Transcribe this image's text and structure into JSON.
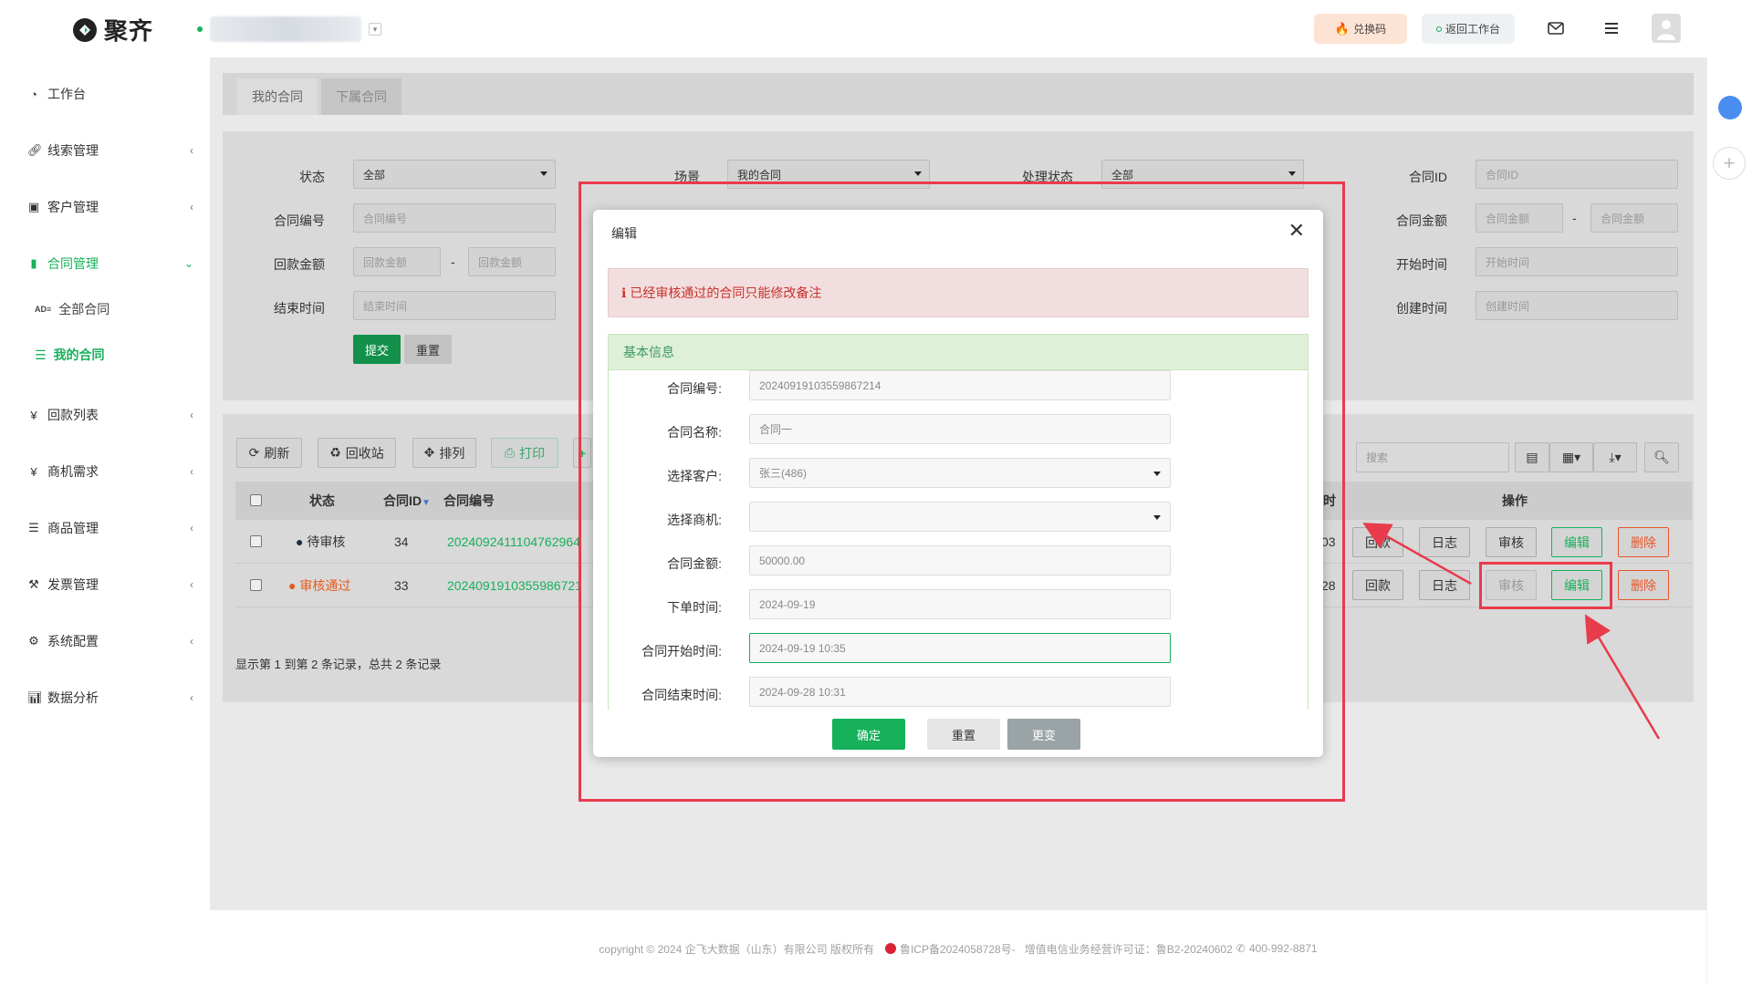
{
  "app": {
    "logo_text": "聚齐"
  },
  "topbar": {
    "redeem_label": "兑换码",
    "back_label": "返回工作台"
  },
  "sidebar": {
    "items": [
      {
        "label": "工作台",
        "icon": "dashboard-icon"
      },
      {
        "label": "线索管理",
        "icon": "link-icon"
      },
      {
        "label": "客户管理",
        "icon": "id-card-icon"
      },
      {
        "label": "合同管理",
        "icon": "bookmark-icon",
        "active": true
      },
      {
        "label": "全部合同",
        "icon": "ad-icon"
      },
      {
        "label": "我的合同",
        "icon": "list-icon",
        "active": true
      },
      {
        "label": "回款列表",
        "icon": "yen-icon"
      },
      {
        "label": "商机需求",
        "icon": "yen-icon"
      },
      {
        "label": "商品管理",
        "icon": "list-icon"
      },
      {
        "label": "发票管理",
        "icon": "gavel-icon"
      },
      {
        "label": "系统配置",
        "icon": "gears-icon"
      },
      {
        "label": "数据分析",
        "icon": "bar-chart-icon"
      }
    ]
  },
  "tabs": [
    "我的合同",
    "下属合同"
  ],
  "filters": {
    "status_label": "状态",
    "status_value": "全部",
    "scene_label": "场景",
    "scene_value": "我的合同",
    "process_label": "处理状态",
    "process_value": "全部",
    "contract_id_label": "合同ID",
    "contract_id_ph": "合同ID",
    "contract_no_label": "合同编号",
    "contract_no_ph": "合同编号",
    "amount_label": "合同金额",
    "amount_ph": "合同金额",
    "refund_label": "回款金额",
    "refund_ph": "回款金额",
    "start_label": "开始时间",
    "start_ph": "开始时间",
    "end_label": "结束时间",
    "end_ph": "结束时间",
    "created_label": "创建时间",
    "created_ph": "创建时间",
    "dash": "-",
    "submit": "提交",
    "reset": "重置"
  },
  "toolbar": {
    "refresh": "刷新",
    "recycle": "回收站",
    "sort": "排列",
    "print": "打印",
    "search_ph": "搜索"
  },
  "table": {
    "headers": {
      "status": "状态",
      "id": "合同ID",
      "no": "合同编号",
      "time_tail": "时",
      "ops": "操作"
    },
    "rows": [
      {
        "status": "待审核",
        "status_color": "#1f2a44",
        "id": "34",
        "no": "20240924111047629​64",
        "time_tail": "03"
      },
      {
        "status": "审核通过",
        "status_color": "#e85a1b",
        "id": "33",
        "no": "202409191035598672​1",
        "time_tail": "28"
      }
    ],
    "ops": {
      "refund": "回款",
      "log": "日志",
      "audit": "审核",
      "edit": "编辑",
      "delete": "删除"
    },
    "summary": "显示第 1 到第 2 条记录，总共 2 条记录"
  },
  "modal": {
    "title": "编辑",
    "warning": "已经审核通过的合同只能修改备注",
    "section": "基本信息",
    "fields": [
      {
        "label": "合同编号:",
        "value": "20240919103559867214"
      },
      {
        "label": "合同名称:",
        "value": "合同一"
      },
      {
        "label": "选择客户:",
        "value": "张三(486)"
      },
      {
        "label": "选择商机:",
        "value": ""
      },
      {
        "label": "合同金额:",
        "value": "50000.00"
      },
      {
        "label": "下单时间:",
        "value": "2024-09-19"
      },
      {
        "label": "合同开始时间:",
        "value": "2024-09-19 10:35"
      },
      {
        "label": "合同结束时间:",
        "value": "2024-09-28 10:31"
      }
    ],
    "confirm": "确定",
    "reset": "重置",
    "change": "更变"
  },
  "footer": {
    "copyright": "copyright © 2024 企飞大数据（山东）有限公司 版权所有",
    "icp": "鲁ICP备2024058728号-",
    "license": "增值电信业务经营许可证：鲁B2-20240602",
    "phone": "400-992-8871"
  },
  "colors": {
    "brand_green": "#16b15a",
    "danger": "#e83b4c",
    "warn_orange": "#e85a1b"
  }
}
